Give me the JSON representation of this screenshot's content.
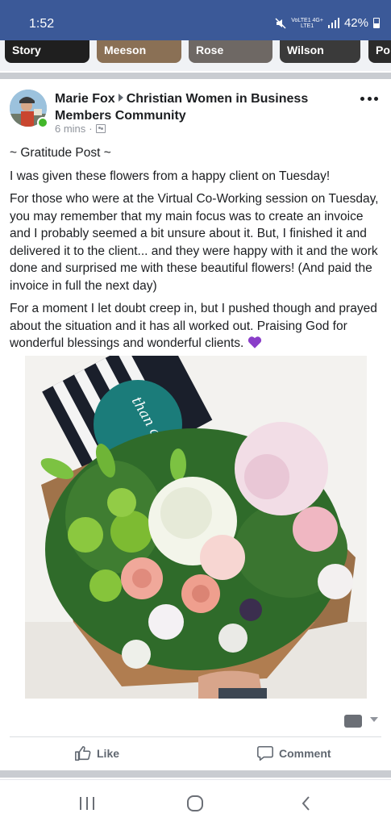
{
  "status_bar": {
    "time": "1:52",
    "network_top": "VoLTE1 4G+",
    "network_bottom": "LTE1",
    "battery": "42%"
  },
  "stories": [
    {
      "label": "Story"
    },
    {
      "label": "Meeson"
    },
    {
      "label": "Rose"
    },
    {
      "label": "Wilson"
    },
    {
      "label": "Po"
    }
  ],
  "post": {
    "author": "Marie Fox",
    "group": "Christian Women in Business Members Community",
    "time": "6 mins",
    "privacy_icon": "group-icon",
    "paragraphs": [
      "~ Gratitude Post ~",
      "I was given these flowers from a happy client on Tuesday!",
      "For those who were at the Virtual Co-Working session on Tuesday, you may remember that my main focus was to create an invoice and I probably seemed a bit unsure about it. But, I finished it and delivered it to the client... and they were happy with it and the work done and surprised me with these beautiful flowers! (And paid the invoice in full the next day)",
      "For a moment I let doubt creep in, but I pushed though and prayed about the situation and it has all worked out. Praising God for wonderful blessings and wonderful clients."
    ],
    "emoji": "purple-heart",
    "photo_card_text": "than a bun"
  },
  "actions": {
    "like_label": "Like",
    "comment_label": "Comment"
  },
  "colors": {
    "status_bar": "#3b5998",
    "online": "#42b72a",
    "heart": "#8a3ec9"
  }
}
